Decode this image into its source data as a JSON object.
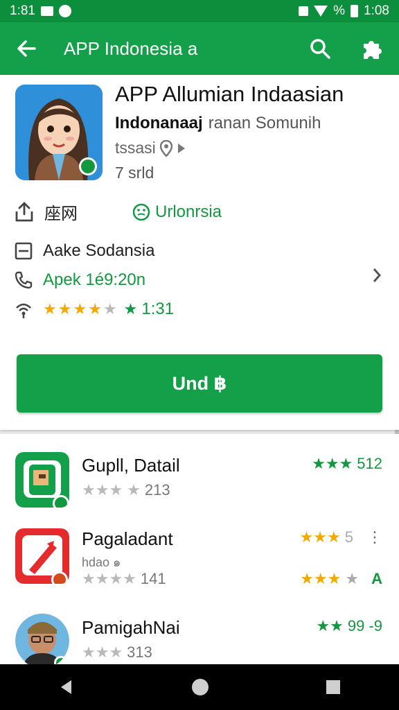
{
  "status_bar": {
    "time_left": "1:81",
    "battery": "%",
    "time_right": "1:08"
  },
  "app_bar": {
    "title": "APP Indonesia a"
  },
  "app": {
    "name": "APP Allumian Indaasian",
    "developer": "Indonanaaj",
    "developer_sub": "ranan Somunih",
    "location": "tssasi",
    "size": "7 srld"
  },
  "info": {
    "share_label": "座网",
    "status_label": "Urlonrsia",
    "category_label": "Aake Sodansia",
    "phone_label": "Apek 1é9:20n",
    "rating_value": "1:31"
  },
  "install_button": {
    "label": "Und ฿"
  },
  "related": [
    {
      "name": "Gupll, Datail",
      "meta": "213",
      "right": "512"
    },
    {
      "name": "Pagaladant",
      "sub": "hdao ๑",
      "meta": "141",
      "right_top": "5",
      "right_bottom": "A"
    },
    {
      "name": "PamigahNai",
      "meta": "313",
      "right": "99 -9"
    }
  ],
  "colors": {
    "primary": "#14a04a",
    "status": "#0c8f3c",
    "star": "#f2a900"
  }
}
